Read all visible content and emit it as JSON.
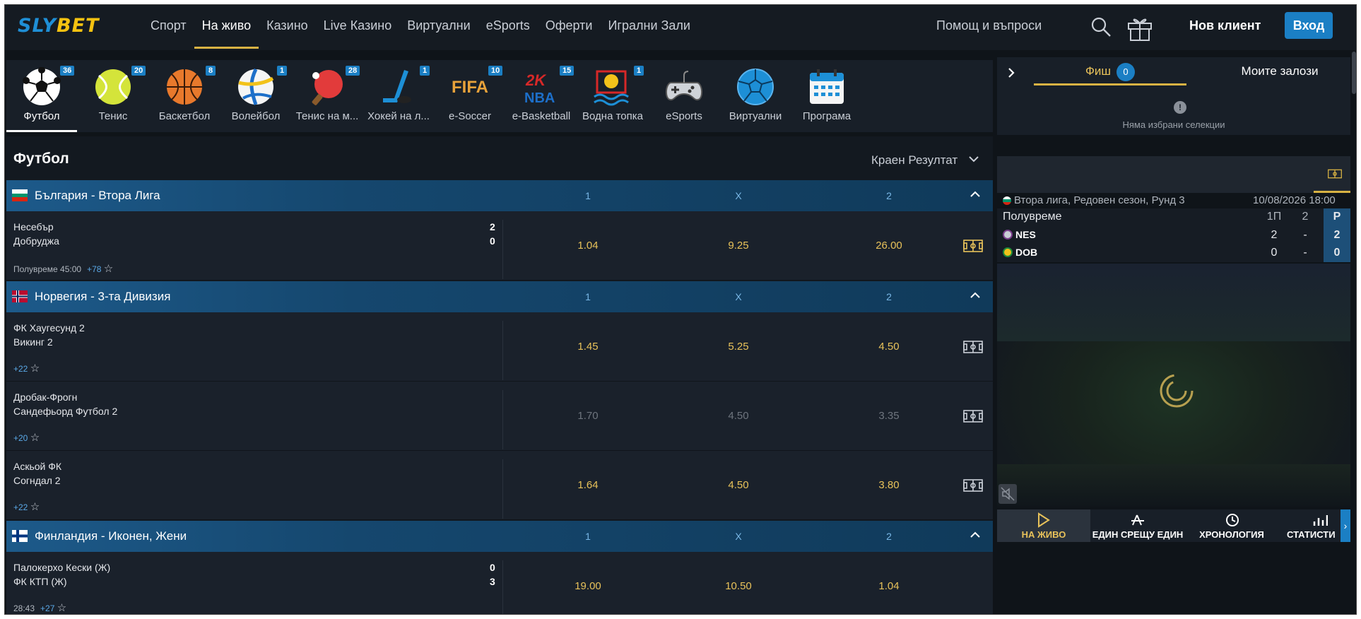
{
  "header": {
    "logo_left": "SLY",
    "logo_right": "BET",
    "nav": [
      "Спорт",
      "На живо",
      "Казино",
      "Live Казино",
      "Виртуални",
      "eSports",
      "Оферти",
      "Игрални Зали"
    ],
    "active_nav": "На живо",
    "help": "Помощ и въпроси",
    "new_client": "Нов клиент",
    "login": "Вход"
  },
  "sports": [
    {
      "label": "Футбол",
      "count": "36",
      "icon": "soccer-ball-icon"
    },
    {
      "label": "Тенис",
      "count": "20",
      "icon": "tennis-ball-icon"
    },
    {
      "label": "Баскетбол",
      "count": "8",
      "icon": "basketball-icon"
    },
    {
      "label": "Волейбол",
      "count": "1",
      "icon": "volleyball-icon"
    },
    {
      "label": "Тенис на м...",
      "count": "28",
      "icon": "table-tennis-icon"
    },
    {
      "label": "Хокей на л...",
      "count": "1",
      "icon": "ice-hockey-icon"
    },
    {
      "label": "e-Soccer",
      "count": "10",
      "icon": "fifa-icon"
    },
    {
      "label": "e-Basketball",
      "count": "15",
      "icon": "nba2k-icon"
    },
    {
      "label": "Водна топка",
      "count": "1",
      "icon": "water-polo-icon"
    },
    {
      "label": "eSports",
      "count": "",
      "icon": "gamepad-icon"
    },
    {
      "label": "Виртуални",
      "count": "",
      "icon": "virtual-ball-icon"
    },
    {
      "label": "Програма",
      "count": "",
      "icon": "calendar-icon"
    }
  ],
  "main": {
    "title": "Футбол",
    "market": "Краен Резултат",
    "col1": "1",
    "colx": "X",
    "col2": "2"
  },
  "leagues": [
    {
      "name": "България - Втора Лига",
      "flag": "bulgaria-flag",
      "matches": [
        {
          "home": "Несебър",
          "away": "Добруджа",
          "score_home": "2",
          "score_away": "0",
          "status": "Полувреме",
          "time": "45:00",
          "more": "+78",
          "odds": [
            "1.04",
            "9.25",
            "26.00"
          ],
          "suspended": false
        }
      ]
    },
    {
      "name": "Норвегия - 3-та Дивизия",
      "flag": "norway-flag",
      "matches": [
        {
          "home": "ФК Хаугесунд 2",
          "away": "Викинг 2",
          "score_home": "",
          "score_away": "",
          "status": "",
          "time": "",
          "more": "+22",
          "odds": [
            "1.45",
            "5.25",
            "4.50"
          ],
          "suspended": false
        },
        {
          "home": "Дробак-Фрогн",
          "away": "Сандефьорд Футбол 2",
          "score_home": "",
          "score_away": "",
          "status": "",
          "time": "",
          "more": "+20",
          "odds": [
            "1.70",
            "4.50",
            "3.35"
          ],
          "suspended": true
        },
        {
          "home": "Аскьой ФК",
          "away": "Согндал 2",
          "score_home": "",
          "score_away": "",
          "status": "",
          "time": "",
          "more": "+22",
          "odds": [
            "1.64",
            "4.50",
            "3.80"
          ],
          "suspended": false
        }
      ]
    },
    {
      "name": "Финландия - Иконен, Жени",
      "flag": "finland-flag",
      "matches": [
        {
          "home": "Палокерхо Кески (Ж)",
          "away": "ФК КТП (Ж)",
          "score_home": "0",
          "score_away": "3",
          "status": "",
          "time": "28:43",
          "more": "+27",
          "odds": [
            "19.00",
            "10.50",
            "1.04"
          ],
          "suspended": false
        }
      ]
    }
  ],
  "betslip": {
    "tab_slip": "Фиш",
    "slip_count": "0",
    "tab_mybets": "Моите залози",
    "empty": "Няма избрани селекции"
  },
  "scoreboard": {
    "league": "Втора лига, Редовен сезон, Рунд 3",
    "datetime": "10/08/2026 18:00",
    "period": "Полувреме",
    "headers": [
      "1П",
      "2",
      "Р"
    ],
    "home": {
      "name": "NES",
      "values": [
        "2",
        "-",
        "2"
      ]
    },
    "away": {
      "name": "DOB",
      "values": [
        "0",
        "-",
        "0"
      ]
    }
  },
  "tracker_tabs": [
    "НА ЖИВО",
    "ЕДИН СРЕЩУ ЕДИН",
    "ХРОНОЛОГИЯ",
    "СТАТИСТИ"
  ],
  "colors": {
    "accent": "#d8b243",
    "brand_blue": "#1b7fc4",
    "odds": "#e8c25a",
    "bg": "#0f1419"
  }
}
